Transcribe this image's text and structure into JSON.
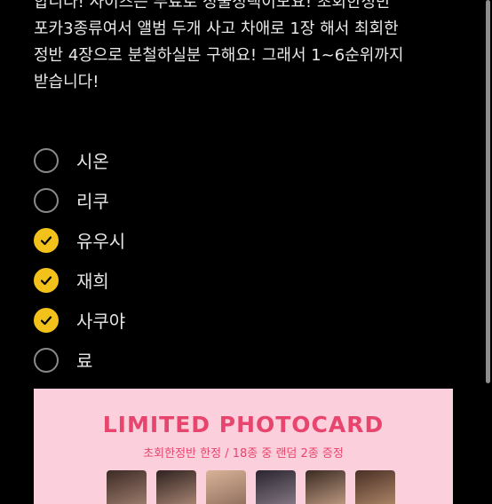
{
  "description": {
    "lines": [
      "합니다! 사이즈는 무료로 정물정택이모요! 초회한정반",
      "포카3종류여서 앨범 두개 사고 차애로 1장 해서 최회한",
      "정반 4장으로 분철하실분 구해요! 그래서 1~6순위까지",
      "받습니다!"
    ]
  },
  "options": [
    {
      "label": "시온",
      "checked": false
    },
    {
      "label": "리쿠",
      "checked": false
    },
    {
      "label": "유우시",
      "checked": true
    },
    {
      "label": "재희",
      "checked": true
    },
    {
      "label": "사쿠야",
      "checked": true
    },
    {
      "label": "료",
      "checked": false
    }
  ],
  "banner": {
    "title": "LIMITED PHOTOCARD",
    "subtitle": "초회한정반 한정 / 18종 중 랜덤 2종 증정"
  },
  "colors": {
    "accent": "#f2c21b",
    "banner_bg": "#fbcfdb",
    "banner_text": "#e8456e"
  }
}
